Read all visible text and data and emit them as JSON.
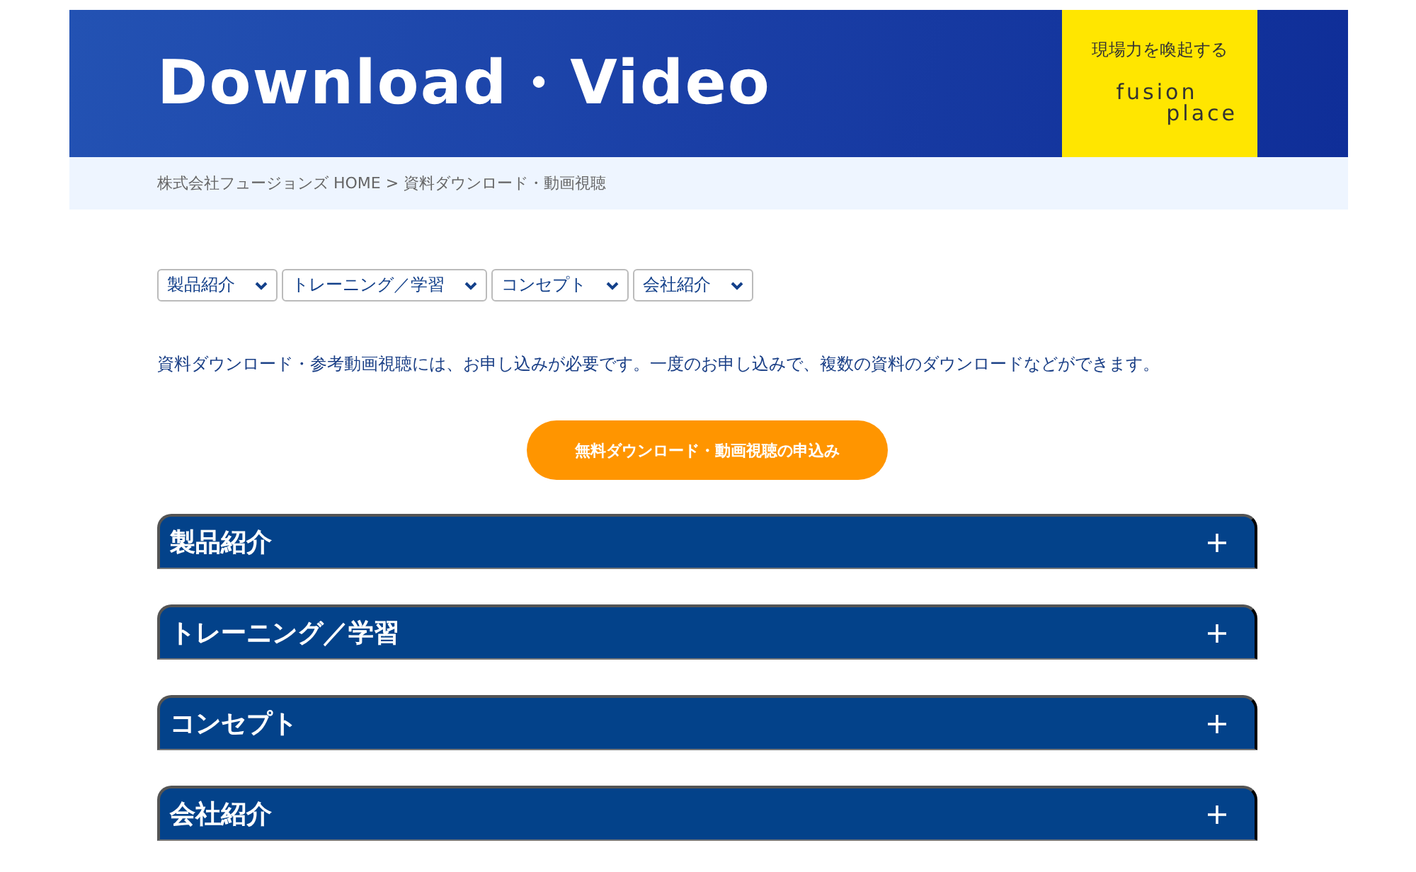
{
  "header": {
    "title": "Download・Video",
    "tagline": "現場力を喚起する",
    "logo_line_1": "fusion",
    "logo_line_2": "place"
  },
  "breadcrumb": {
    "text": "株式会社フュージョンズ HOME > 資料ダウンロード・動画視聴"
  },
  "filters": [
    {
      "label": "製品紹介"
    },
    {
      "label": "トレーニング／学習"
    },
    {
      "label": "コンセプト"
    },
    {
      "label": "会社紹介"
    }
  ],
  "intro": "資料ダウンロード・参考動画視聴には、お申し込みが必要です。一度のお申し込みで、複数の資料のダウンロードなどができます。",
  "cta_button": "無料ダウンロード・動画視聴の申込み",
  "sections": [
    {
      "title": "製品紹介",
      "expanded": false
    },
    {
      "title": "トレーニング／学習",
      "expanded": false
    },
    {
      "title": "コンセプト",
      "expanded": false
    },
    {
      "title": "会社紹介",
      "expanded": false
    }
  ]
}
